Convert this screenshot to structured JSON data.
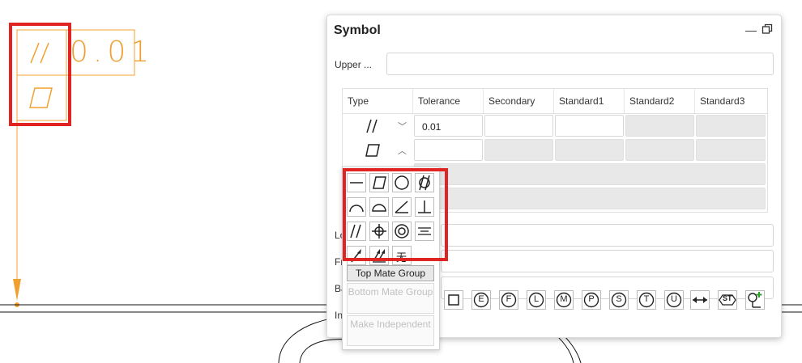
{
  "drawing": {
    "tolerance_value": "0.01"
  },
  "dialog": {
    "title": "Symbol",
    "minimize_glyph": "—",
    "upper_label": "Upper ...",
    "upper_value": "",
    "lower_label_partial": "Lo",
    "frame_label_partial": "Fr",
    "bottom_label_partial": "Ba",
    "indicator_label_partial": "In",
    "columns": [
      "Type",
      "Tolerance",
      "Secondary",
      "Standard1",
      "Standard2",
      "Standard3"
    ],
    "rows": [
      {
        "type_icon": "parallelism-icon",
        "tolerance": "0.01",
        "expanded": false
      },
      {
        "type_icon": "flatness-icon",
        "tolerance": "",
        "expanded": true
      }
    ],
    "chevron_down": "﹀",
    "chevron_up": "︿"
  },
  "popup": {
    "symbols": [
      "straightness-icon",
      "flatness-icon",
      "circularity-icon",
      "cylindricity-icon",
      "line-profile-icon",
      "surface-profile-icon",
      "angularity-icon",
      "perpendicularity-icon",
      "parallelism-icon",
      "position-icon",
      "concentricity-icon",
      "symmetry-icon",
      "circular-runout-icon",
      "total-runout-icon",
      "none-icon"
    ],
    "none_label": "无",
    "buttons": [
      {
        "label": "Top Mate Group",
        "enabled": true
      },
      {
        "label": "Bottom Mate Group",
        "enabled": false
      },
      {
        "label": "Make Independent",
        "enabled": false
      }
    ]
  },
  "modifiers": {
    "circled": [
      "E",
      "F",
      "L",
      "M",
      "P",
      "S",
      "T",
      "U"
    ],
    "st_label": "ST",
    "icons": [
      "square-icon",
      "between-icon",
      "statistical-icon",
      "add-datum-icon"
    ]
  },
  "colors": {
    "annotation": "#f0a030",
    "highlight": "#e02424",
    "disabled_cell": "#e8e8e8"
  }
}
